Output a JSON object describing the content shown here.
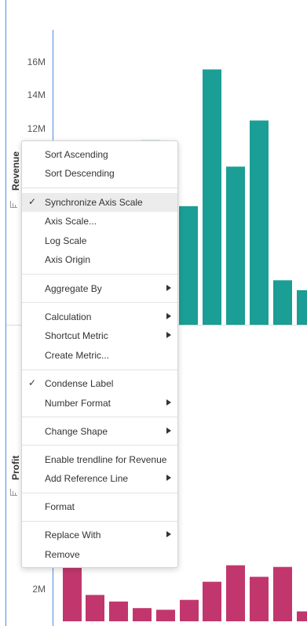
{
  "charts": [
    {
      "type": "bar",
      "ylabel": "Revenue",
      "y_ticks": [
        "12M",
        "14M",
        "16M"
      ],
      "color": "#1a9e96",
      "values_in_millions": [
        11.2,
        7.2,
        15.5,
        9.6,
        12.4,
        2.7,
        2.1
      ]
    },
    {
      "type": "bar",
      "ylabel": "Profit",
      "y_ticks": [
        "2M"
      ],
      "color": "#c1376d",
      "values_in_millions": [
        3.6,
        1.6,
        1.2,
        0.8,
        0.7,
        1.3,
        2.4,
        3.4,
        2.7,
        3.3,
        0.6,
        0.9
      ]
    }
  ],
  "context_menu": {
    "items": [
      {
        "label": "Sort Ascending",
        "checked": false,
        "submenu": false
      },
      {
        "label": "Sort Descending",
        "checked": false,
        "submenu": false
      },
      {
        "label": "Synchronize Axis Scale",
        "checked": true,
        "submenu": false,
        "highlighted": true
      },
      {
        "label": "Axis Scale...",
        "checked": false,
        "submenu": false
      },
      {
        "label": "Log Scale",
        "checked": false,
        "submenu": false
      },
      {
        "label": "Axis Origin",
        "checked": false,
        "submenu": false
      },
      {
        "label": "Aggregate By",
        "checked": false,
        "submenu": true
      },
      {
        "label": "Calculation",
        "checked": false,
        "submenu": true
      },
      {
        "label": "Shortcut Metric",
        "checked": false,
        "submenu": true
      },
      {
        "label": "Create Metric...",
        "checked": false,
        "submenu": false
      },
      {
        "label": "Condense Label",
        "checked": true,
        "submenu": false
      },
      {
        "label": "Number Format",
        "checked": false,
        "submenu": true
      },
      {
        "label": "Change Shape",
        "checked": false,
        "submenu": true
      },
      {
        "label": "Enable trendline for Revenue",
        "checked": false,
        "submenu": false
      },
      {
        "label": "Add Reference Line",
        "checked": false,
        "submenu": true
      },
      {
        "label": "Format",
        "checked": false,
        "submenu": false
      },
      {
        "label": "Replace With",
        "checked": false,
        "submenu": true
      },
      {
        "label": "Remove",
        "checked": false,
        "submenu": false
      }
    ]
  },
  "chart_data": [
    {
      "type": "bar",
      "title": "",
      "ylabel": "Revenue",
      "yticks": [
        "12M",
        "14M",
        "16M"
      ],
      "values": [
        11200000,
        7200000,
        15500000,
        9600000,
        12400000,
        2700000,
        2100000
      ],
      "note": "partially obscured by context menu"
    },
    {
      "type": "bar",
      "title": "",
      "ylabel": "Profit",
      "yticks": [
        "2M"
      ],
      "values": [
        3600000,
        1600000,
        1200000,
        800000,
        700000,
        1300000,
        2400000,
        3400000,
        2700000,
        3300000,
        600000,
        900000
      ],
      "note": "partially obscured by context menu"
    }
  ]
}
